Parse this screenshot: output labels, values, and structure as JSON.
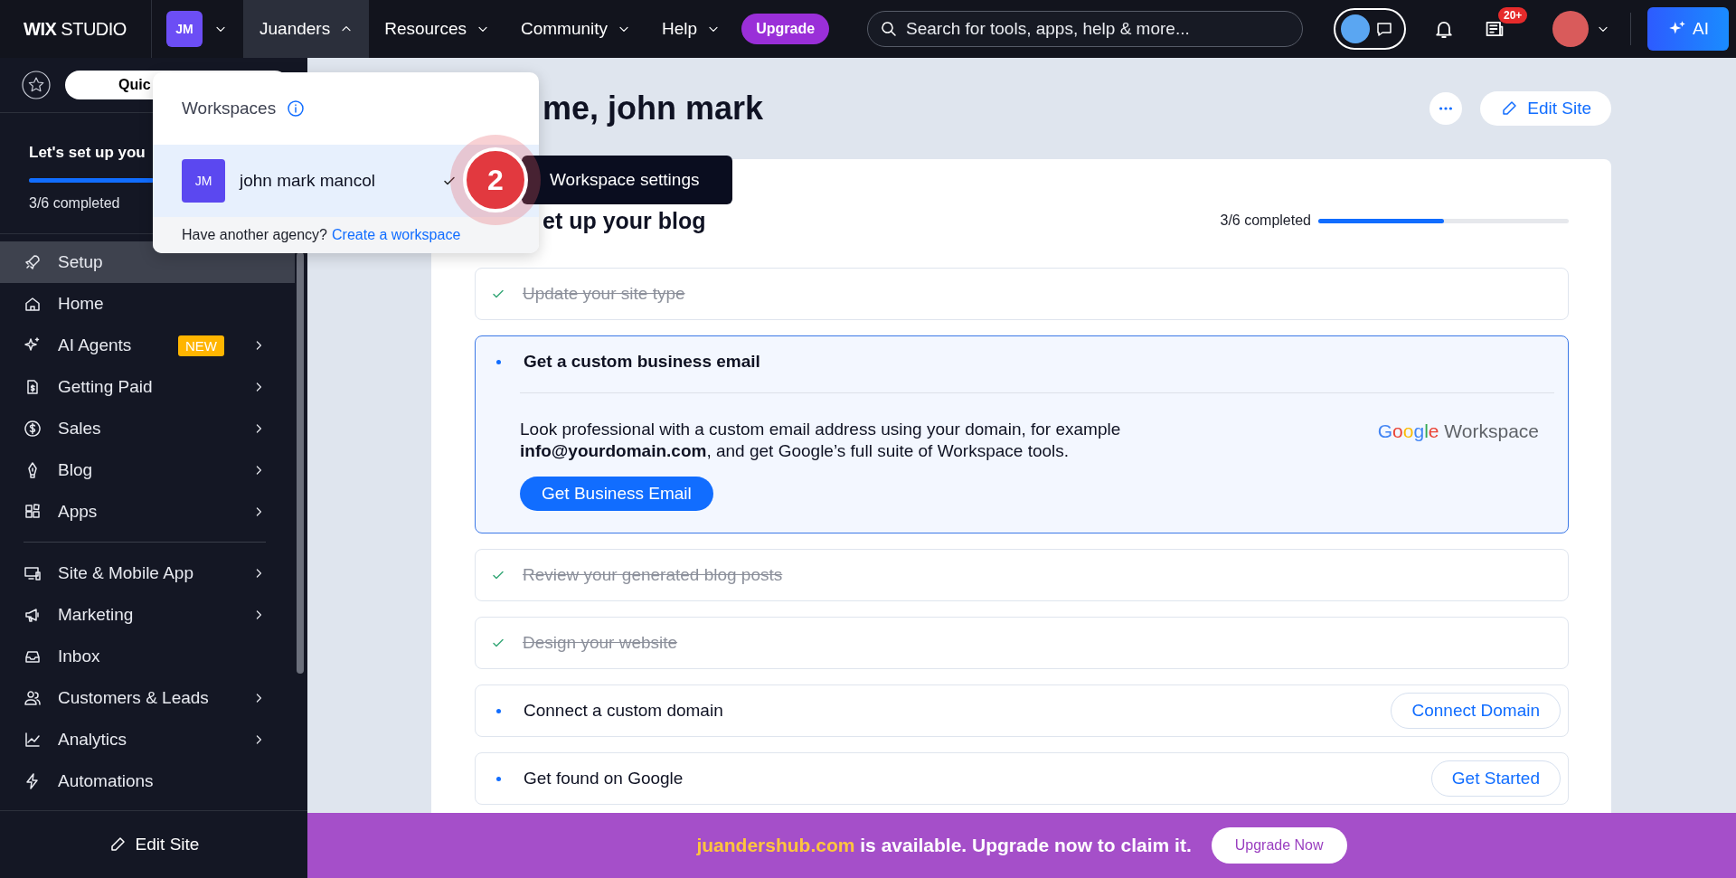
{
  "top_bar": {
    "logo": "**WIX** STUDIO",
    "workspace_initials": "JM",
    "menus": [
      {
        "label": "Juanders",
        "expanded": true
      },
      {
        "label": "Resources",
        "expanded": false
      },
      {
        "label": "Community",
        "expanded": false
      },
      {
        "label": "Help",
        "expanded": false
      }
    ],
    "upgrade_button": "Upgrade",
    "search": {
      "placeholder": "Search for tools, apps, help & more..."
    },
    "notifications_badge": "20+",
    "ai_button": "AI"
  },
  "sidebar": {
    "quick_access": "Quic",
    "setup_title": "Let's set up you",
    "setup_bar": {
      "level": 0.5
    },
    "setup_progress": "3/6 completed",
    "nav_groups": [
      [
        {
          "label": "Setup",
          "selected": true,
          "submenu": false
        },
        {
          "label": "Home",
          "selected": false,
          "submenu": false
        },
        {
          "label": "AI Agents",
          "selected": false,
          "submenu": true,
          "badge": "NEW"
        },
        {
          "label": "Getting Paid",
          "selected": false,
          "submenu": true
        },
        {
          "label": "Sales",
          "selected": false,
          "submenu": true
        },
        {
          "label": "Blog",
          "selected": false,
          "submenu": true
        },
        {
          "label": "Apps",
          "selected": false,
          "submenu": true
        }
      ],
      [
        {
          "label": "Site & Mobile App",
          "selected": false,
          "submenu": true
        },
        {
          "label": "Marketing",
          "selected": false,
          "submenu": true
        },
        {
          "label": "Inbox",
          "selected": false,
          "submenu": false
        },
        {
          "label": "Customers & Leads",
          "selected": false,
          "submenu": true
        },
        {
          "label": "Analytics",
          "selected": false,
          "submenu": true
        },
        {
          "label": "Automations",
          "selected": false,
          "submenu": false
        }
      ]
    ],
    "footer_button": "Edit Site"
  },
  "workspace_menu": {
    "title": "Workspaces",
    "workspaces": [
      {
        "initials": "JM",
        "name": "john mark mancol",
        "selected": true
      }
    ],
    "footer_text": "Have another agency?",
    "footer_link": "Create a workspace"
  },
  "step_marker": "2",
  "tooltip": "Workspace settings",
  "main": {
    "heading": "me, john mark",
    "edit_button": "Edit Site",
    "checklist": {
      "title": "et up your blog",
      "progress_text": "3/6 completed",
      "level": 0.5,
      "tasks": [
        {
          "label": "Update your site type",
          "done": true,
          "expanded": false
        },
        {
          "label": "Get a custom business email",
          "done": false,
          "expanded": true,
          "description": "Look professional with a custom email address using your domain, for example **info@yourdomain.com**, and get Google’s full suite of Workspace tools.",
          "button": "Get Business Email",
          "partner_logo": "Google Workspace"
        },
        {
          "label": "Review your generated blog posts",
          "done": true,
          "expanded": false
        },
        {
          "label": "Design your website",
          "done": true,
          "expanded": false
        },
        {
          "label": "Connect a custom domain",
          "done": false,
          "expanded": false,
          "button": "Connect Domain"
        },
        {
          "label": "Get found on Google",
          "done": false,
          "expanded": false,
          "button": "Get Started"
        }
      ]
    }
  },
  "banner": {
    "domain": "juandershub.com",
    "message": "is available. Upgrade now to claim it.",
    "button": "Upgrade Now"
  }
}
